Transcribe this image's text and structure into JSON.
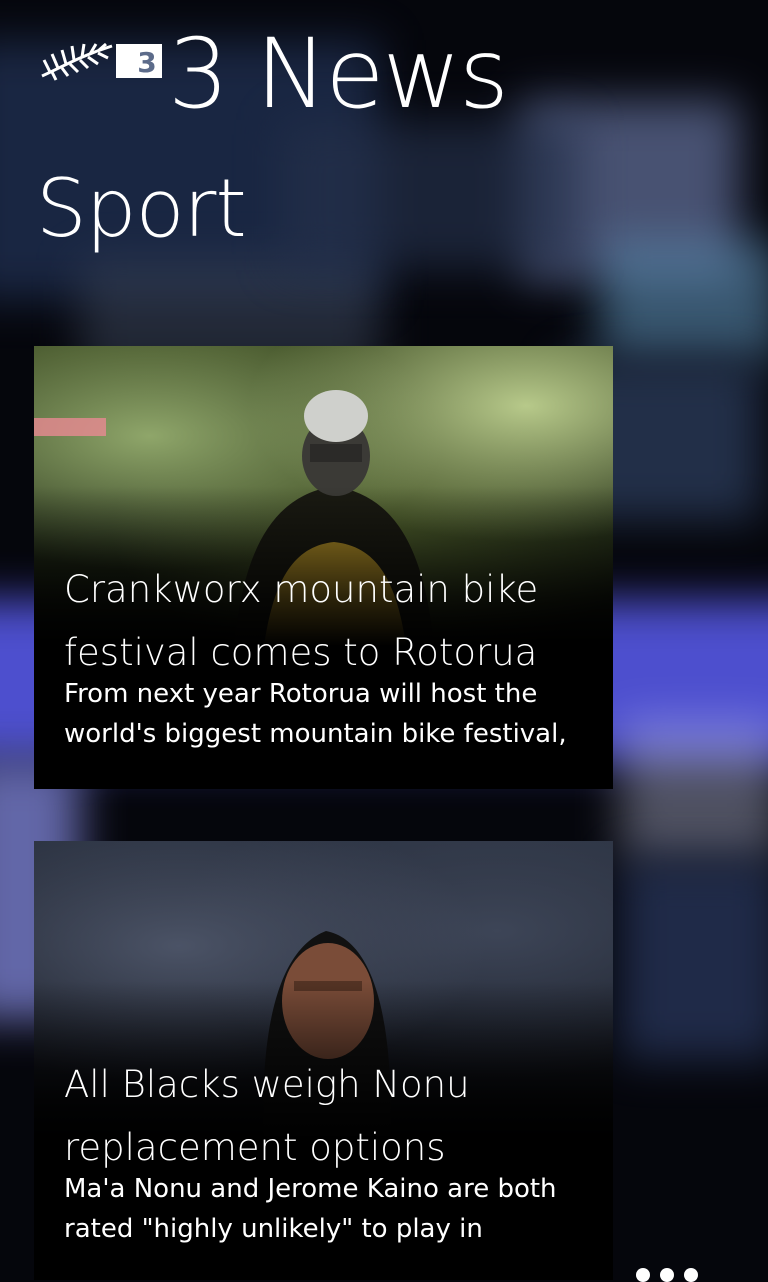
{
  "app": {
    "logo_text": "3",
    "title": "3 News"
  },
  "section": {
    "title": "Sport"
  },
  "articles": [
    {
      "headline": "Crankworx mountain bike festival comes to Rotorua",
      "summary": "From next year Rotorua will host the world's biggest mountain bike festival,",
      "image": "mountain-biker-photo"
    },
    {
      "headline": "All Blacks weigh Nonu replacement options",
      "summary": "Ma'a Nonu and Jerome Kaino are both rated \"highly unlikely\" to play in",
      "image": "rugby-player-photo"
    }
  ],
  "app_bar": {
    "more_icon": "ellipsis-icon"
  },
  "colors": {
    "card_background": "#000000",
    "text": "#ffffff",
    "accent_glow": "#5a5cf0"
  }
}
